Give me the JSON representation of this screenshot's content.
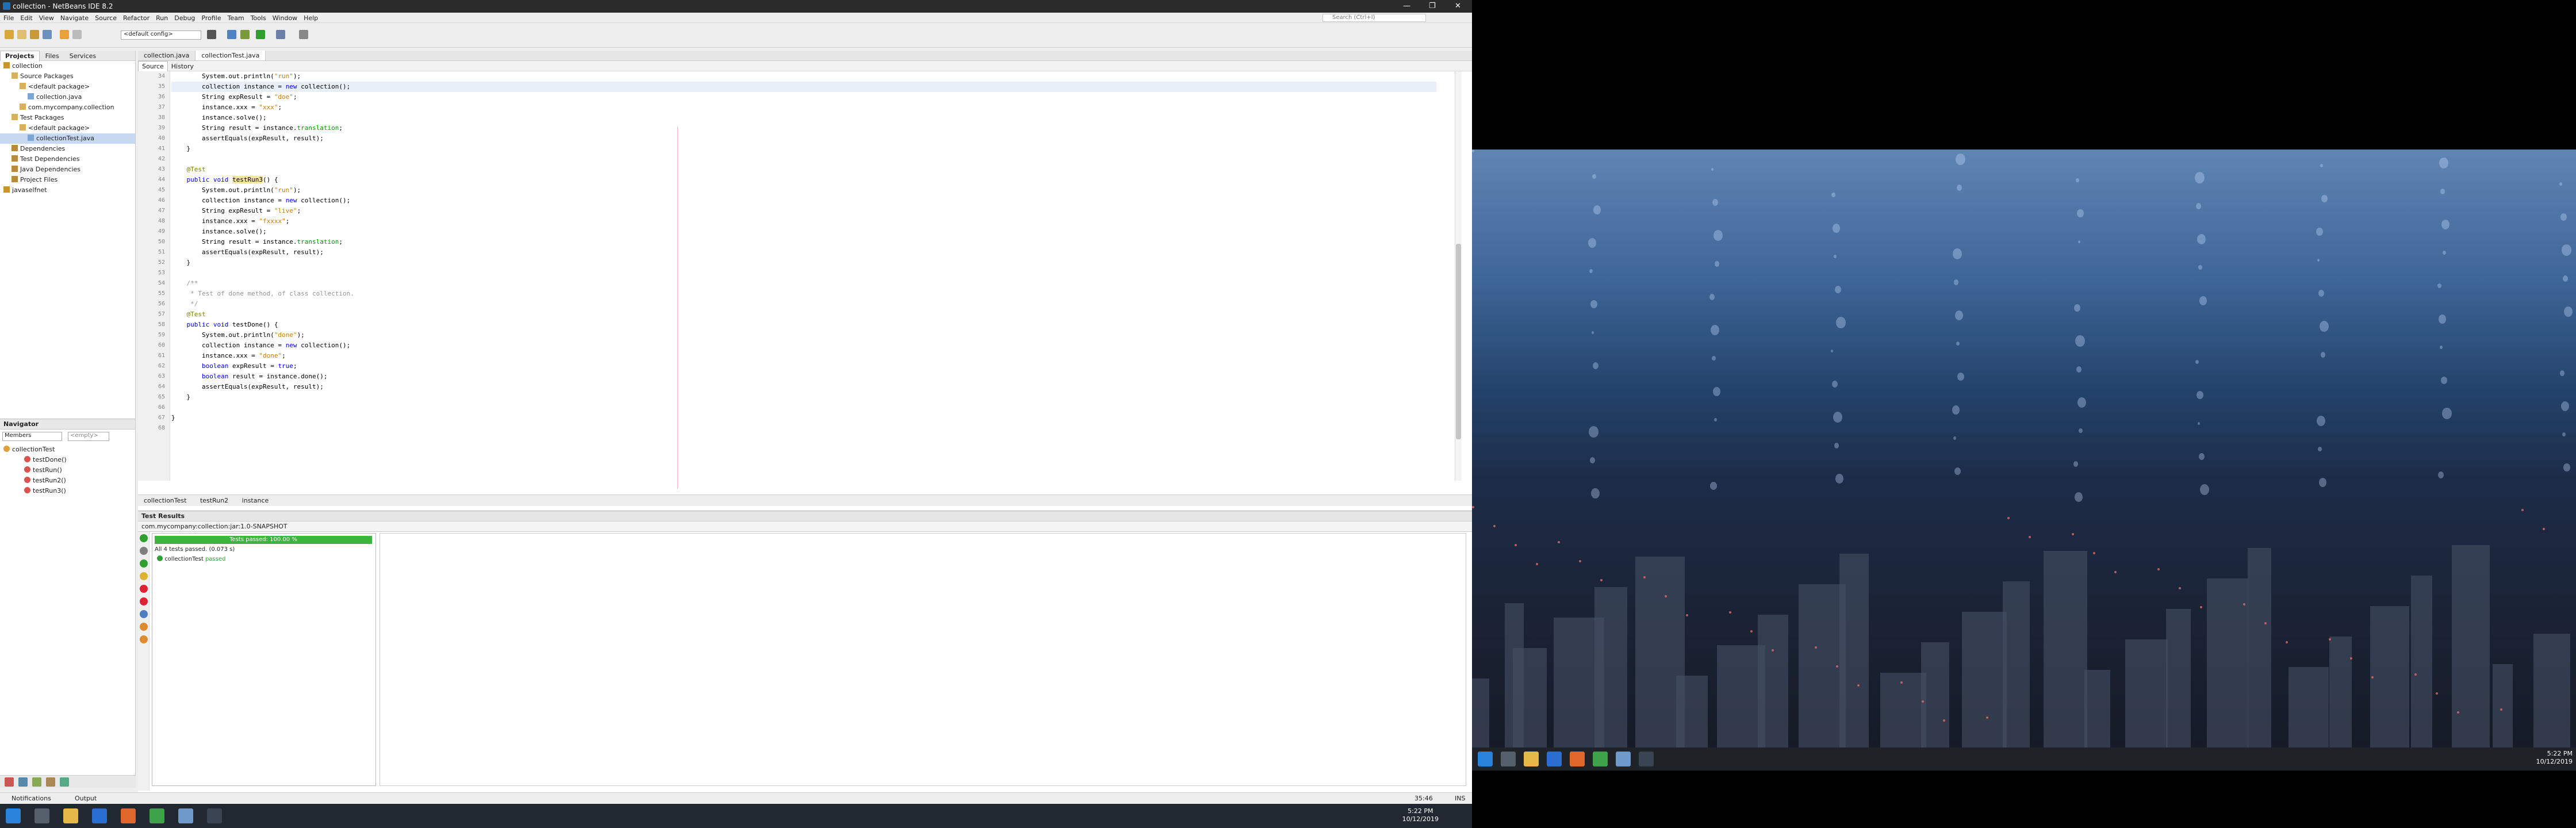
{
  "window": {
    "title": "collection - NetBeans IDE 8.2",
    "minimize": "—",
    "maximize": "❐",
    "close": "✕"
  },
  "menu": [
    "File",
    "Edit",
    "View",
    "Navigate",
    "Source",
    "Refactor",
    "Run",
    "Debug",
    "Profile",
    "Team",
    "Tools",
    "Window",
    "Help"
  ],
  "search_placeholder": "Search (Ctrl+I)",
  "toolbar": {
    "config": "<default config>"
  },
  "projects": {
    "tabs": [
      "Projects",
      "Files",
      "Services"
    ],
    "tree": [
      {
        "label": "collection",
        "depth": 0,
        "color": "#c9962d"
      },
      {
        "label": "Source Packages",
        "depth": 1,
        "color": "#d8b25a"
      },
      {
        "label": "<default package>",
        "depth": 2,
        "color": "#d8b25a"
      },
      {
        "label": "collection.java",
        "depth": 3,
        "color": "#7ea6d4"
      },
      {
        "label": "com.mycompany.collection",
        "depth": 2,
        "color": "#d8b25a"
      },
      {
        "label": "Test Packages",
        "depth": 1,
        "color": "#d8b25a"
      },
      {
        "label": "<default package>",
        "depth": 2,
        "color": "#d8b25a"
      },
      {
        "label": "collectionTest.java",
        "depth": 3,
        "color": "#7ea6d4",
        "selected": true
      },
      {
        "label": "Dependencies",
        "depth": 1,
        "color": "#b88a3a"
      },
      {
        "label": "Test Dependencies",
        "depth": 1,
        "color": "#b88a3a"
      },
      {
        "label": "Java Dependencies",
        "depth": 1,
        "color": "#b88a3a"
      },
      {
        "label": "Project Files",
        "depth": 1,
        "color": "#b88a3a"
      },
      {
        "label": "javaselfnet",
        "depth": 0,
        "color": "#c9962d"
      }
    ]
  },
  "navigator": {
    "title": "Navigator",
    "filter": "Members",
    "empty": "<empty>",
    "items": [
      {
        "label": "collectionTest",
        "depth": 0
      },
      {
        "label": "testDone()",
        "depth": 1
      },
      {
        "label": "testRun()",
        "depth": 1
      },
      {
        "label": "testRun2()",
        "depth": 1
      },
      {
        "label": "testRun3()",
        "depth": 1
      }
    ]
  },
  "editor": {
    "tabs": [
      "collection.java",
      "collectionTest.java"
    ],
    "modes": [
      "Source",
      "History"
    ],
    "lines": [
      {
        "n": "34",
        "t": "        System.out.println(\"run\");"
      },
      {
        "n": "35",
        "t": "        collection instance = new collection();",
        "cur": true
      },
      {
        "n": "36",
        "t": "        String expResult = \"doe\";"
      },
      {
        "n": "37",
        "t": "        instance.xxx = \"xxx\";"
      },
      {
        "n": "38",
        "t": "        instance.solve();"
      },
      {
        "n": "39",
        "t": "        String result = instance.translation;"
      },
      {
        "n": "40",
        "t": "        assertEquals(expResult, result);"
      },
      {
        "n": "41",
        "t": "    }"
      },
      {
        "n": "42",
        "t": ""
      },
      {
        "n": "43",
        "t": "    @Test"
      },
      {
        "n": "44",
        "t": "    public void testRun3() {",
        "hl": "testRun3"
      },
      {
        "n": "45",
        "t": "        System.out.println(\"run\");"
      },
      {
        "n": "46",
        "t": "        collection instance = new collection();"
      },
      {
        "n": "47",
        "t": "        String expResult = \"live\";"
      },
      {
        "n": "48",
        "t": "        instance.xxx = \"fxxxx\";"
      },
      {
        "n": "49",
        "t": "        instance.solve();"
      },
      {
        "n": "50",
        "t": "        String result = instance.translation;"
      },
      {
        "n": "51",
        "t": "        assertEquals(expResult, result);"
      },
      {
        "n": "52",
        "t": "    }"
      },
      {
        "n": "53",
        "t": ""
      },
      {
        "n": "54",
        "t": "    /**"
      },
      {
        "n": "55",
        "t": "     * Test of done method, of class collection."
      },
      {
        "n": "56",
        "t": "     */"
      },
      {
        "n": "57",
        "t": "    @Test"
      },
      {
        "n": "58",
        "t": "    public void testDone() {"
      },
      {
        "n": "59",
        "t": "        System.out.println(\"done\");"
      },
      {
        "n": "60",
        "t": "        collection instance = new collection();"
      },
      {
        "n": "61",
        "t": "        instance.xxx = \"done\";"
      },
      {
        "n": "62",
        "t": "        boolean expResult = true;"
      },
      {
        "n": "63",
        "t": "        boolean result = instance.done();"
      },
      {
        "n": "64",
        "t": "        assertEquals(expResult, result);"
      },
      {
        "n": "65",
        "t": "    }"
      },
      {
        "n": "66",
        "t": ""
      },
      {
        "n": "67",
        "t": "}"
      },
      {
        "n": "68",
        "t": ""
      }
    ],
    "breadcrumbs": [
      "collectionTest",
      "testRun2",
      "instance"
    ]
  },
  "results": {
    "title": "Test Results",
    "subtab": "com.mycompany:collection:jar:1.0-SNAPSHOT",
    "progress_label": "Tests passed: 100.00 %",
    "progress": 1.0,
    "summary": "All 4 tests passed. (0.073 s)",
    "suite": "collectionTest",
    "suite_status": "passed"
  },
  "status": {
    "notifications": "Notifications",
    "output": "Output",
    "position": "35:46",
    "mode": "INS"
  },
  "taskbar": {
    "time": "5:22 PM",
    "date": "10/12/2019"
  },
  "desktop_taskbar": {
    "time": "5:22 PM",
    "date": "10/12/2019"
  },
  "colors": {
    "progress_green": "#3cb53c",
    "selection": "#c6d9f1",
    "keyword": "#0000e6",
    "string": "#ce7b00"
  }
}
